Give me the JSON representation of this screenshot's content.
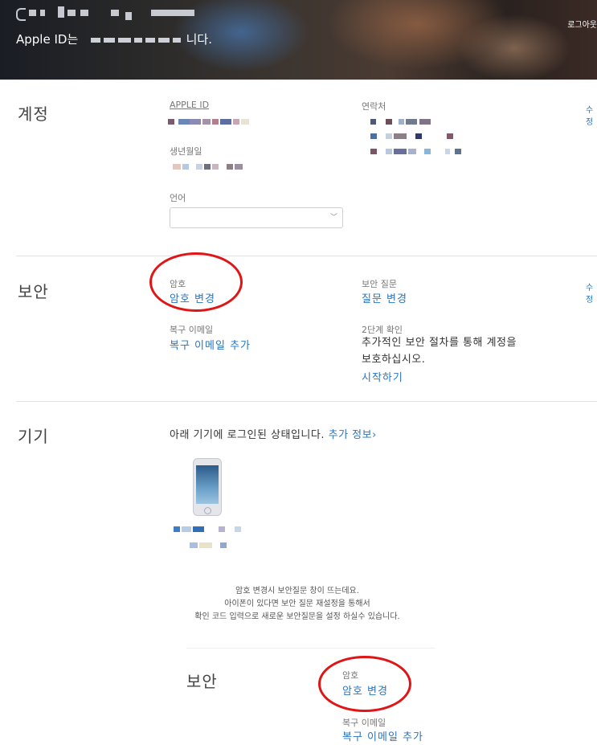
{
  "header": {
    "id_line_prefix": "Apple ID는",
    "id_line_suffix": "니다.",
    "logout_label": "로그아웃"
  },
  "account": {
    "section_title": "계정",
    "apple_id_label": "APPLE ID",
    "birthdate_label": "생년월일",
    "language_label": "언어",
    "language_value": "",
    "contact_label": "연락처",
    "edit_label": "수정"
  },
  "security": {
    "section_title": "보안",
    "password_label": "암호",
    "change_password_link": "암호 변경",
    "security_questions_label": "보안 질문",
    "change_questions_link": "질문 변경",
    "rescue_email_label": "복구 이메일",
    "add_rescue_email_link": "복구 이메일 추가",
    "two_step_label": "2단계 확인",
    "two_step_description_line1": "추가적인 보안 절차를 통해 계정을",
    "two_step_description_line2": "보호하십시오.",
    "get_started_link": "시작하기",
    "edit_label": "수정"
  },
  "devices": {
    "section_title": "기기",
    "intro_text": "아래 기기에 로그인된 상태입니다.",
    "more_info_link": "추가 정보",
    "more_info_chevron": "›",
    "device_icon": "iphone-icon"
  },
  "note": {
    "line1": "암호 변경시 보안질문 창이 뜨는데요.",
    "line2": "아이폰이 있다면 보안 질문 재설정을 통해서",
    "line3": "확인 코드 입력으로 새로운 보안질문을 설정 하실수 있습니다."
  },
  "security_zoom": {
    "section_title": "보안",
    "password_label": "암호",
    "change_password_link": "암호 변경",
    "rescue_email_label": "복구 이메일",
    "add_rescue_email_link": "복구 이메일 추가"
  },
  "colors": {
    "link": "#2a75c0",
    "highlight_circle": "#e01616",
    "divider": "#e2e2e2"
  }
}
